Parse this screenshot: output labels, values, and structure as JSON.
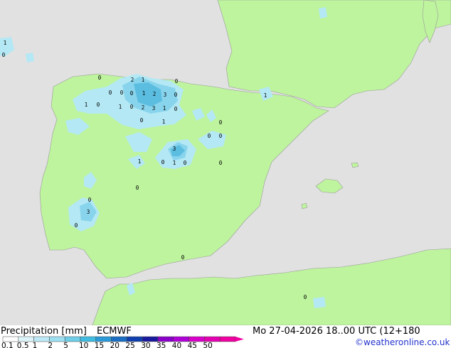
{
  "map": {
    "sea_color": "#e1e1e1",
    "land_color": "#bef49e",
    "precip_colors": [
      "#d7f2f8",
      "#b3e8f4",
      "#88d4ec",
      "#5bbde0",
      "#2ba9d9"
    ],
    "values": [
      {
        "id": "v1",
        "text": "1"
      },
      {
        "id": "v2",
        "text": "0"
      },
      {
        "id": "v3",
        "text": "0"
      },
      {
        "id": "v4",
        "text": "2"
      },
      {
        "id": "v5",
        "text": "1"
      },
      {
        "id": "v6",
        "text": "0"
      },
      {
        "id": "v7",
        "text": "0"
      },
      {
        "id": "v8",
        "text": "0"
      },
      {
        "id": "v9",
        "text": "0"
      },
      {
        "id": "v10",
        "text": "1"
      },
      {
        "id": "v11",
        "text": "2"
      },
      {
        "id": "v12",
        "text": "3"
      },
      {
        "id": "v13",
        "text": "0"
      },
      {
        "id": "v14",
        "text": "1"
      },
      {
        "id": "v15",
        "text": "1"
      },
      {
        "id": "v16",
        "text": "0"
      },
      {
        "id": "v17",
        "text": "1"
      },
      {
        "id": "v18",
        "text": "0"
      },
      {
        "id": "v19",
        "text": "2"
      },
      {
        "id": "v20",
        "text": "3"
      },
      {
        "id": "v21",
        "text": "1"
      },
      {
        "id": "v22",
        "text": "0"
      },
      {
        "id": "v23",
        "text": "0"
      },
      {
        "id": "v24",
        "text": "1"
      },
      {
        "id": "v25",
        "text": "0"
      },
      {
        "id": "v26",
        "text": "0"
      },
      {
        "id": "v27",
        "text": "0"
      },
      {
        "id": "v28",
        "text": "3"
      },
      {
        "id": "v29",
        "text": "1"
      },
      {
        "id": "v30",
        "text": "0"
      },
      {
        "id": "v31",
        "text": "1"
      },
      {
        "id": "v32",
        "text": "0"
      },
      {
        "id": "v33",
        "text": "0"
      },
      {
        "id": "v34",
        "text": "0"
      },
      {
        "id": "v35",
        "text": "0"
      },
      {
        "id": "v36",
        "text": "3"
      },
      {
        "id": "v37",
        "text": "0"
      },
      {
        "id": "v38",
        "text": "0"
      },
      {
        "id": "v39",
        "text": "0"
      },
      {
        "id": "v40",
        "text": "1"
      }
    ]
  },
  "footer": {
    "title": "Precipitation [mm]",
    "model": "ECMWF",
    "valid": "Mo 27-04-2026 18..00 UTC (12+180",
    "credit": "©weatheronline.co.uk",
    "scale_labels": [
      "0.1",
      "0.5",
      "1",
      "2",
      "5",
      "10",
      "15",
      "20",
      "25",
      "30",
      "35",
      "40",
      "45",
      "50"
    ],
    "scale_colors": [
      "#ffffff",
      "#ddf5fa",
      "#bdeaf6",
      "#9de0f2",
      "#6fcfe9",
      "#3fbce0",
      "#2a9ad8",
      "#1a6ec4",
      "#0f3fae",
      "#1a1a9e",
      "#8a00c8",
      "#b000d8",
      "#d800c8",
      "#e400b0",
      "#f000a0"
    ]
  }
}
